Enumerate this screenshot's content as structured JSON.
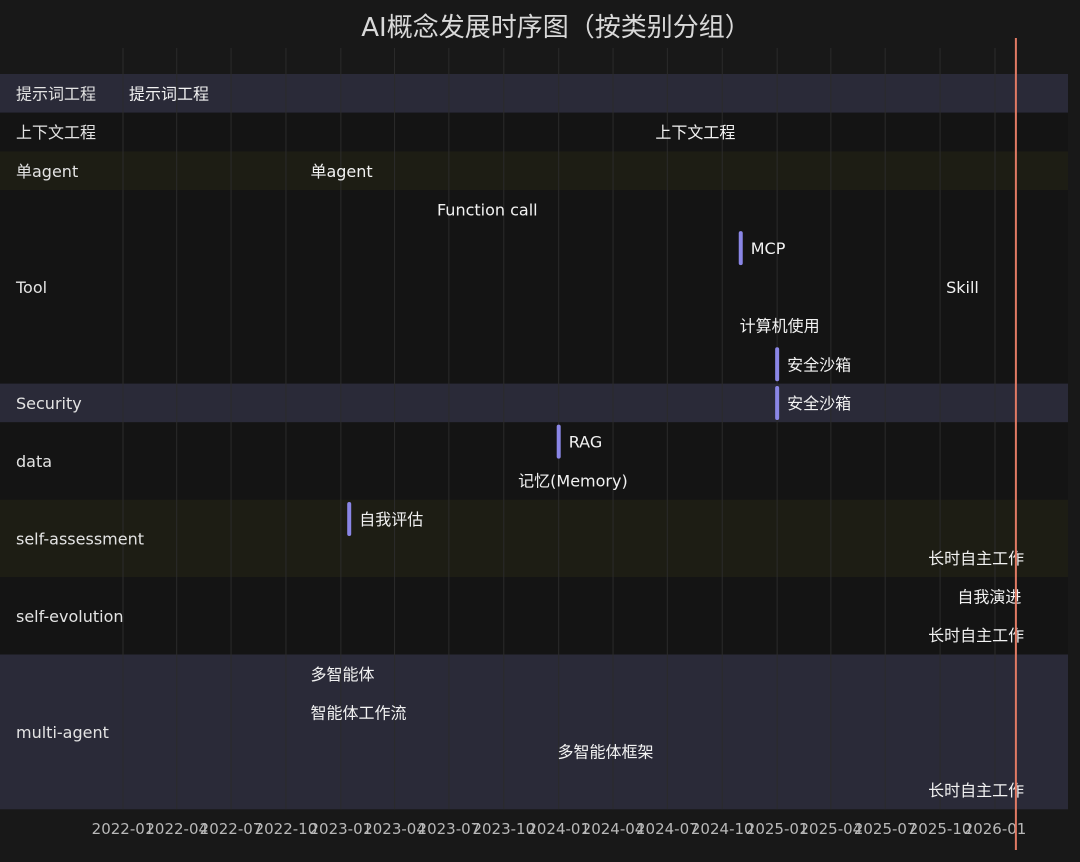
{
  "chart_data": {
    "type": "gantt",
    "title": "AI概念发展时序图（按类别分组）",
    "colors": {
      "background": "#181818",
      "section_band_a": "#2a2a38",
      "section_band_b": "#141414",
      "section_band_c": "#1d1d14",
      "milestone": "#8a86e6",
      "today_line": "#e07a64",
      "grid": "#2b2b2b"
    },
    "x_ticks": [
      "2022-01",
      "2022-04",
      "2022-07",
      "2022-10",
      "2023-01",
      "2023-04",
      "2023-07",
      "2023-10",
      "2024-01",
      "2024-04",
      "2024-07",
      "2024-10",
      "2025-01",
      "2025-04",
      "2025-07",
      "2025-10",
      "2026-01"
    ],
    "x_range": [
      "2021-10-01",
      "2026-04-01"
    ],
    "today": "2026-02-05",
    "sections": [
      {
        "name": "提示词工程",
        "band": "a",
        "tasks": [
          {
            "label": "提示词工程",
            "start": "2022-01-01",
            "milestone": false
          }
        ]
      },
      {
        "name": "上下文工程",
        "band": "b",
        "tasks": [
          {
            "label": "上下文工程",
            "start": "2024-06-01",
            "milestone": false
          }
        ]
      },
      {
        "name": "单agent",
        "band": "c",
        "tasks": [
          {
            "label": "单agent",
            "start": "2022-11-01",
            "milestone": false
          }
        ]
      },
      {
        "name": "Tool",
        "band": "b",
        "tasks": [
          {
            "label": "Function call",
            "start": "2023-06-01",
            "milestone": false
          },
          {
            "label": "MCP",
            "start": "2024-11-01",
            "milestone": true
          },
          {
            "label": "Skill",
            "start": "2025-10-01",
            "milestone": false
          },
          {
            "label": "计算机使用",
            "start": "2024-10-20",
            "milestone": false
          },
          {
            "label": "安全沙箱",
            "start": "2025-01-01",
            "milestone": true
          }
        ]
      },
      {
        "name": "Security",
        "band": "a",
        "tasks": [
          {
            "label": "安全沙箱",
            "start": "2025-01-01",
            "milestone": true
          }
        ]
      },
      {
        "name": "data",
        "band": "b",
        "tasks": [
          {
            "label": "RAG",
            "start": "2024-01-01",
            "milestone": true
          },
          {
            "label": "记忆(Memory)",
            "start": "2023-10-15",
            "milestone": false
          }
        ]
      },
      {
        "name": "self-assessment",
        "band": "c",
        "tasks": [
          {
            "label": "自我评估",
            "start": "2023-01-15",
            "milestone": true
          },
          {
            "label": "长时自主工作",
            "start": "2025-09-01",
            "milestone": false
          }
        ]
      },
      {
        "name": "self-evolution",
        "band": "b",
        "tasks": [
          {
            "label": "自我演进",
            "start": "2025-10-20",
            "milestone": false
          },
          {
            "label": "长时自主工作",
            "start": "2025-09-01",
            "milestone": false
          }
        ]
      },
      {
        "name": "multi-agent",
        "band": "a",
        "tasks": [
          {
            "label": "多智能体",
            "start": "2022-11-01",
            "milestone": false
          },
          {
            "label": "智能体工作流",
            "start": "2022-11-01",
            "milestone": false
          },
          {
            "label": "多智能体框架",
            "start": "2023-12-20",
            "milestone": false
          },
          {
            "label": "长时自主工作",
            "start": "2025-09-01",
            "milestone": false
          }
        ]
      }
    ]
  }
}
